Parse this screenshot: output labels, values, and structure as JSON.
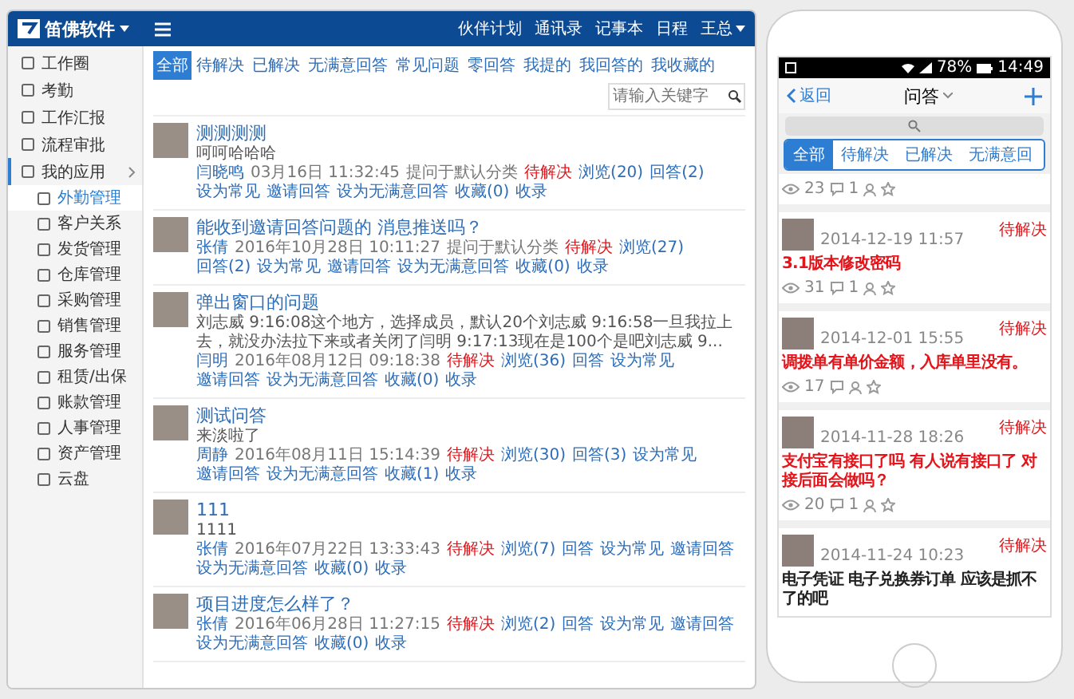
{
  "tablet": {
    "header": {
      "logo": "笛佛软件",
      "nav_links": [
        "伙伴计划",
        "通讯录",
        "记事本",
        "日程"
      ],
      "user": "王总"
    },
    "sidebar": {
      "items": [
        {
          "label": "工作圈",
          "selected": false
        },
        {
          "label": "考勤",
          "selected": false
        },
        {
          "label": "工作汇报",
          "selected": false
        },
        {
          "label": "流程审批",
          "selected": false
        },
        {
          "label": "我的应用",
          "selected": false,
          "expanded": true,
          "children": [
            {
              "label": "外勤管理",
              "selected": true
            },
            {
              "label": "客户关系",
              "selected": false
            },
            {
              "label": "发货管理",
              "selected": false
            },
            {
              "label": "仓库管理",
              "selected": false
            },
            {
              "label": "采购管理",
              "selected": false
            },
            {
              "label": "销售管理",
              "selected": false
            },
            {
              "label": "服务管理",
              "selected": false
            },
            {
              "label": "租赁/出保",
              "selected": false
            },
            {
              "label": "账款管理",
              "selected": false
            },
            {
              "label": "人事管理",
              "selected": false
            },
            {
              "label": "资产管理",
              "selected": false
            },
            {
              "label": "云盘",
              "selected": false
            }
          ]
        }
      ]
    },
    "tabs": [
      {
        "label": "全部",
        "selected": true
      },
      {
        "label": "待解决",
        "selected": false
      },
      {
        "label": "已解决",
        "selected": false
      },
      {
        "label": "无满意回答",
        "selected": false
      },
      {
        "label": "常见问题",
        "selected": false
      },
      {
        "label": "零回答",
        "selected": false
      },
      {
        "label": "我提的",
        "selected": false
      },
      {
        "label": "我回答的",
        "selected": false
      },
      {
        "label": "我收藏的",
        "selected": false
      }
    ],
    "search": {
      "placeholder": "请输入关键字"
    },
    "posts": [
      {
        "title": "测测测测",
        "body": "呵呵哈哈哈",
        "author": "闫晓鸣",
        "time": "03月16日 11:32:45",
        "category": "提问于默认分类",
        "status": "待解决",
        "actions": [
          "浏览(20)",
          "回答(2)",
          "设为常见",
          "邀请回答",
          "设为无满意回答",
          "收藏(0)",
          "收录"
        ]
      },
      {
        "title": "能收到邀请回答问题的 消息推送吗？",
        "author": "张倩",
        "time": "2016年10月28日 10:11:27",
        "category": "提问于默认分类",
        "status": "待解决",
        "actions": [
          "浏览(27)",
          "回答(2)",
          "设为常见",
          "邀请回答",
          "设为无满意回答",
          "收藏(0)",
          "收录"
        ]
      },
      {
        "title": "弹出窗口的问题",
        "body": "刘志威 9:16:08这个地方，选择成员，默认20个刘志威 9:16:58一旦我拉上去，就没办法拉下来或者关闭了闫明 9:17:13现在是100个是吧刘志威 9...",
        "author": "闫明",
        "time": "2016年08月12日 09:18:38",
        "status": "待解决",
        "actions": [
          "浏览(36)",
          "回答",
          "设为常见",
          "邀请回答",
          "设为无满意回答",
          "收藏(0)",
          "收录"
        ]
      },
      {
        "title": "测试问答",
        "body": "来淡啦了",
        "author": "周静",
        "time": "2016年08月11日 15:14:39",
        "status": "待解决",
        "actions": [
          "浏览(30)",
          "回答(3)",
          "设为常见",
          "邀请回答",
          "设为无满意回答",
          "收藏(1)",
          "收录"
        ]
      },
      {
        "title": "111",
        "body": "1111",
        "author": "张倩",
        "time": "2016年07月22日 13:33:43",
        "status": "待解决",
        "actions": [
          "浏览(7)",
          "回答",
          "设为常见",
          "邀请回答",
          "设为无满意回答",
          "收藏(0)",
          "收录"
        ]
      },
      {
        "title": "项目进度怎么样了？",
        "author": "张倩",
        "time": "2016年06月28日 11:27:15",
        "status": "待解决",
        "actions": [
          "浏览(2)",
          "回答",
          "设为常见",
          "邀请回答",
          "设为无满意回答",
          "收藏(0)",
          "收录"
        ]
      }
    ]
  },
  "phone": {
    "status_bar": {
      "battery": "78%",
      "time": "14:49"
    },
    "nav": {
      "back": "返回",
      "title": "问答"
    },
    "tabs": [
      {
        "label": "全部",
        "selected": true
      },
      {
        "label": "待解决",
        "selected": false
      },
      {
        "label": "已解决",
        "selected": false
      },
      {
        "label": "无满意回",
        "selected": false
      }
    ],
    "cards": [
      {
        "views": "23",
        "comments": "1"
      },
      {
        "time": "2014-12-19 11:57",
        "status": "待解决",
        "title": "3.1版本修改密码",
        "highlighted": true,
        "views": "31",
        "comments": "1"
      },
      {
        "time": "2014-12-01 15:55",
        "status": "待解决",
        "title": "调拨单有单价金额，入库单里没有。",
        "highlighted": true,
        "views": "17"
      },
      {
        "time": "2014-11-28 18:26",
        "status": "待解决",
        "title": "支付宝有接口了吗 有人说有接口了 对接后面会做吗？",
        "highlighted": true,
        "views": "20",
        "comments": "1"
      },
      {
        "time": "2014-11-24 10:23",
        "status": "待解决",
        "title": "电子凭证 电子兑换券订单 应该是抓不了的吧",
        "highlighted": false
      }
    ]
  }
}
